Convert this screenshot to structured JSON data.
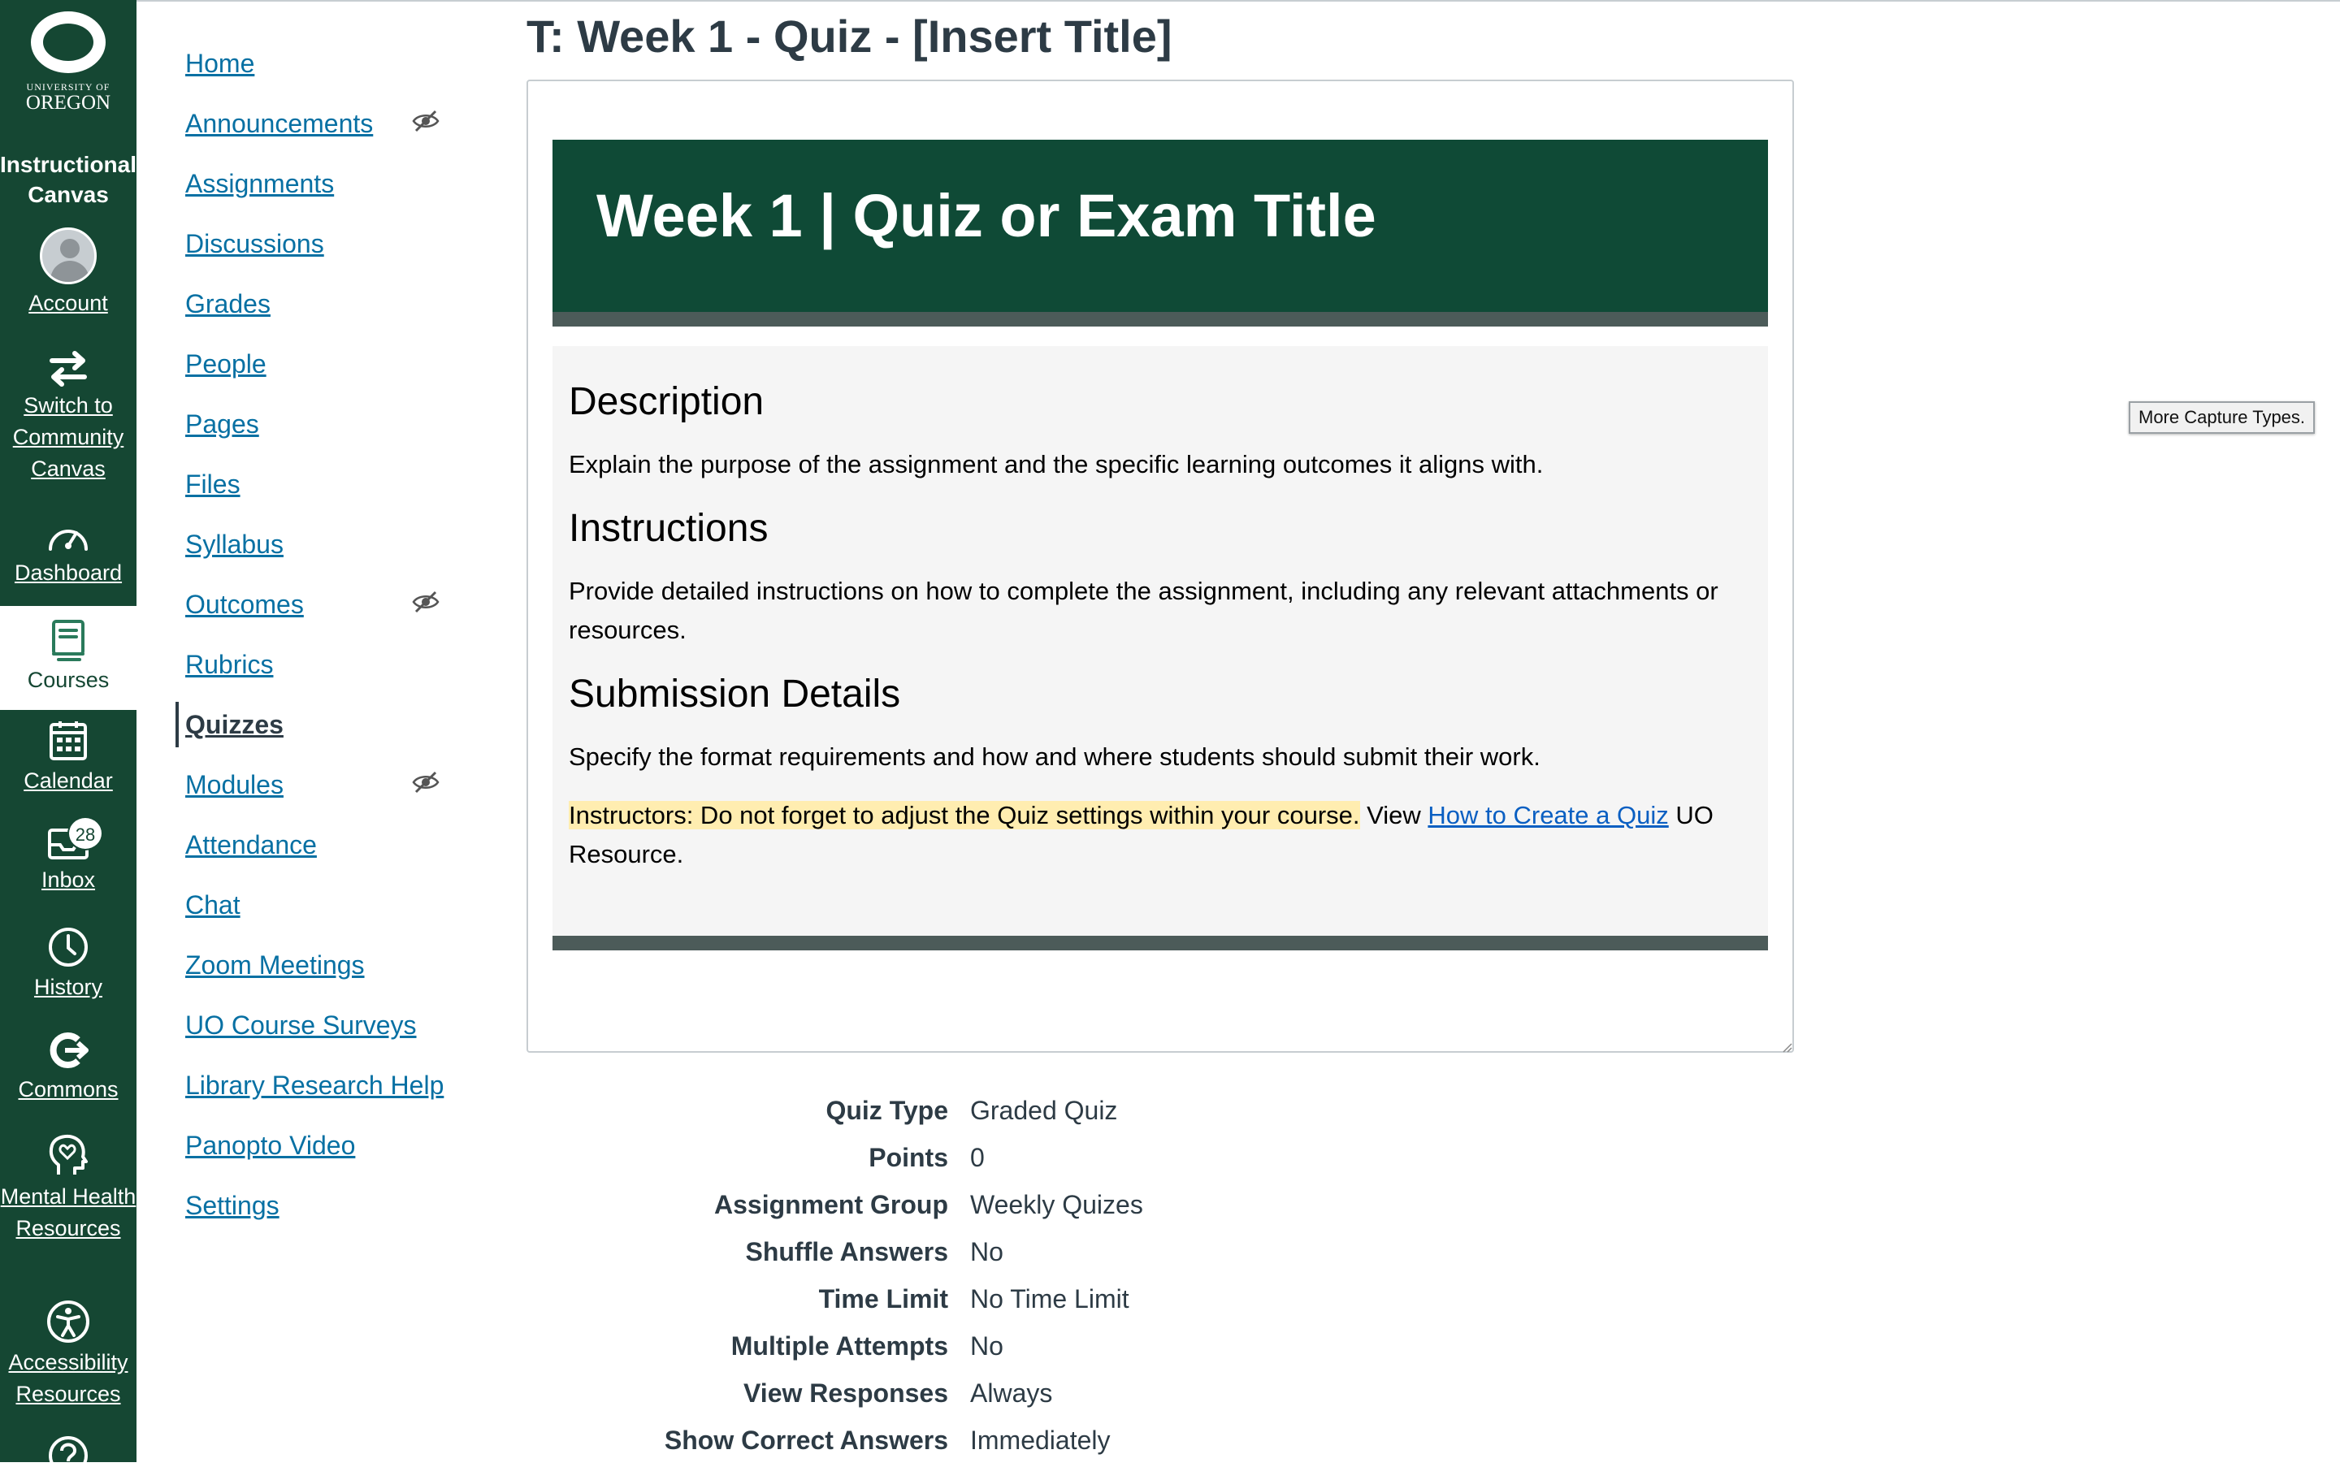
{
  "global_nav": {
    "logo": {
      "university": "UNIVERSITY OF",
      "oregon": "OREGON"
    },
    "brand": "Instructional Canvas",
    "items": [
      {
        "id": "account",
        "label": "Account",
        "icon": "avatar-icon"
      },
      {
        "id": "switch",
        "label": "Switch to Community Canvas",
        "icon": "swap-arrows-icon"
      },
      {
        "id": "dashboard",
        "label": "Dashboard",
        "icon": "speedometer-icon"
      },
      {
        "id": "courses",
        "label": "Courses",
        "icon": "book-icon",
        "active": true
      },
      {
        "id": "calendar",
        "label": "Calendar",
        "icon": "calendar-icon"
      },
      {
        "id": "inbox",
        "label": "Inbox",
        "icon": "inbox-icon",
        "badge": "28"
      },
      {
        "id": "history",
        "label": "History",
        "icon": "clock-icon"
      },
      {
        "id": "commons",
        "label": "Commons",
        "icon": "commons-icon"
      },
      {
        "id": "mental-health",
        "label": "Mental Health Resources",
        "icon": "heart-head-icon"
      },
      {
        "id": "accessibility",
        "label": "Accessibility Resources",
        "icon": "accessibility-icon"
      },
      {
        "id": "help",
        "label": "",
        "icon": "help-icon"
      }
    ]
  },
  "course_nav": {
    "items": [
      {
        "label": "Home"
      },
      {
        "label": "Announcements",
        "hidden_icon": true
      },
      {
        "label": "Assignments"
      },
      {
        "label": "Discussions"
      },
      {
        "label": "Grades"
      },
      {
        "label": "People"
      },
      {
        "label": "Pages"
      },
      {
        "label": "Files"
      },
      {
        "label": "Syllabus"
      },
      {
        "label": "Outcomes",
        "hidden_icon": true
      },
      {
        "label": "Rubrics"
      },
      {
        "label": "Quizzes",
        "active": true
      },
      {
        "label": "Modules",
        "hidden_icon": true
      },
      {
        "label": "Attendance"
      },
      {
        "label": "Chat"
      },
      {
        "label": "Zoom Meetings"
      },
      {
        "label": "UO Course Surveys"
      },
      {
        "label": "Library Research Help"
      },
      {
        "label": "Panopto Video"
      },
      {
        "label": "Settings"
      }
    ]
  },
  "page": {
    "title": "T: Week 1 - Quiz - [Insert Title]",
    "banner_title": "Week 1 | Quiz or Exam Title",
    "description_heading": "Description",
    "description_text": "Explain the purpose of the assignment and the specific learning outcomes it aligns with.",
    "instructions_heading": "Instructions",
    "instructions_text": "Provide detailed instructions on how to complete the assignment, including any relevant attachments or resources.",
    "submission_heading": "Submission Details",
    "submission_text": "Specify the format requirements and how and where students should submit their work.",
    "note_highlight": "Instructors: Do not forget to adjust the Quiz settings within your course.",
    "note_view": " View ",
    "note_link": "How to Create a Quiz",
    "note_after": " UO Resource."
  },
  "quiz_details": [
    {
      "label": "Quiz Type",
      "value": "Graded Quiz"
    },
    {
      "label": "Points",
      "value": "0"
    },
    {
      "label": "Assignment Group",
      "value": "Weekly Quizes"
    },
    {
      "label": "Shuffle Answers",
      "value": "No"
    },
    {
      "label": "Time Limit",
      "value": "No Time Limit"
    },
    {
      "label": "Multiple Attempts",
      "value": "No"
    },
    {
      "label": "View Responses",
      "value": "Always"
    },
    {
      "label": "Show Correct Answers",
      "value": "Immediately"
    }
  ],
  "tooltip": "More Capture Types.",
  "colors": {
    "nav_bg": "#154733",
    "banner": "#0f4a36",
    "link": "#0770a3",
    "highlight": "#ffedb0"
  }
}
